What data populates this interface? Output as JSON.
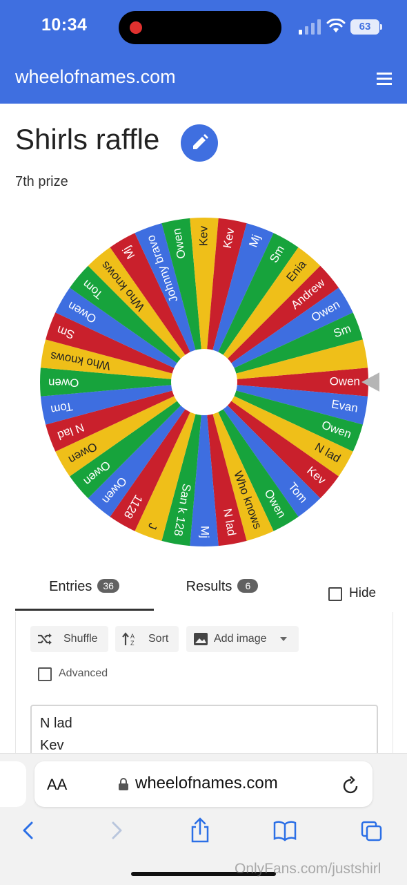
{
  "status_bar": {
    "time": "10:34",
    "battery": "63"
  },
  "header": {
    "site": "wheelofnames.com",
    "menu_icon": "hamburger-icon"
  },
  "wheel": {
    "title": "Shirls raffle",
    "subtitle": "7th prize",
    "colors": [
      "#c9202c",
      "#3e6ee0",
      "#17a33c",
      "#efbf19"
    ],
    "entries_clockwise_from_pointer": [
      "Owen",
      "Evan",
      "Owen",
      "N lad",
      "Kev",
      "Tom",
      "Owen",
      "Who knows",
      "N lad",
      "Mj",
      "San k 128",
      "J",
      "1128",
      "Owen",
      "Owen",
      "Owen",
      "N lad",
      "Tom",
      "Owen",
      "Who knows",
      "Sm",
      "Owen",
      "Tom",
      "Who knows",
      "Mj",
      "Johnny bravo",
      "Owen",
      "Kev",
      "Kev",
      "Mj",
      "Sm",
      "Enia",
      "Andrew",
      "Owen",
      "Sm",
      ""
    ]
  },
  "tabs": {
    "entries_label": "Entries",
    "entries_count": "36",
    "results_label": "Results",
    "results_count": "6",
    "hide_label": "Hide"
  },
  "toolbar": {
    "shuffle": "Shuffle",
    "sort": "Sort",
    "add_image": "Add image",
    "advanced": "Advanced"
  },
  "entries_list": [
    "N lad",
    "Kev"
  ],
  "browser": {
    "aa": "AA",
    "url": "wheelofnames.com"
  },
  "watermark": "OnlyFans.com/justshirl"
}
